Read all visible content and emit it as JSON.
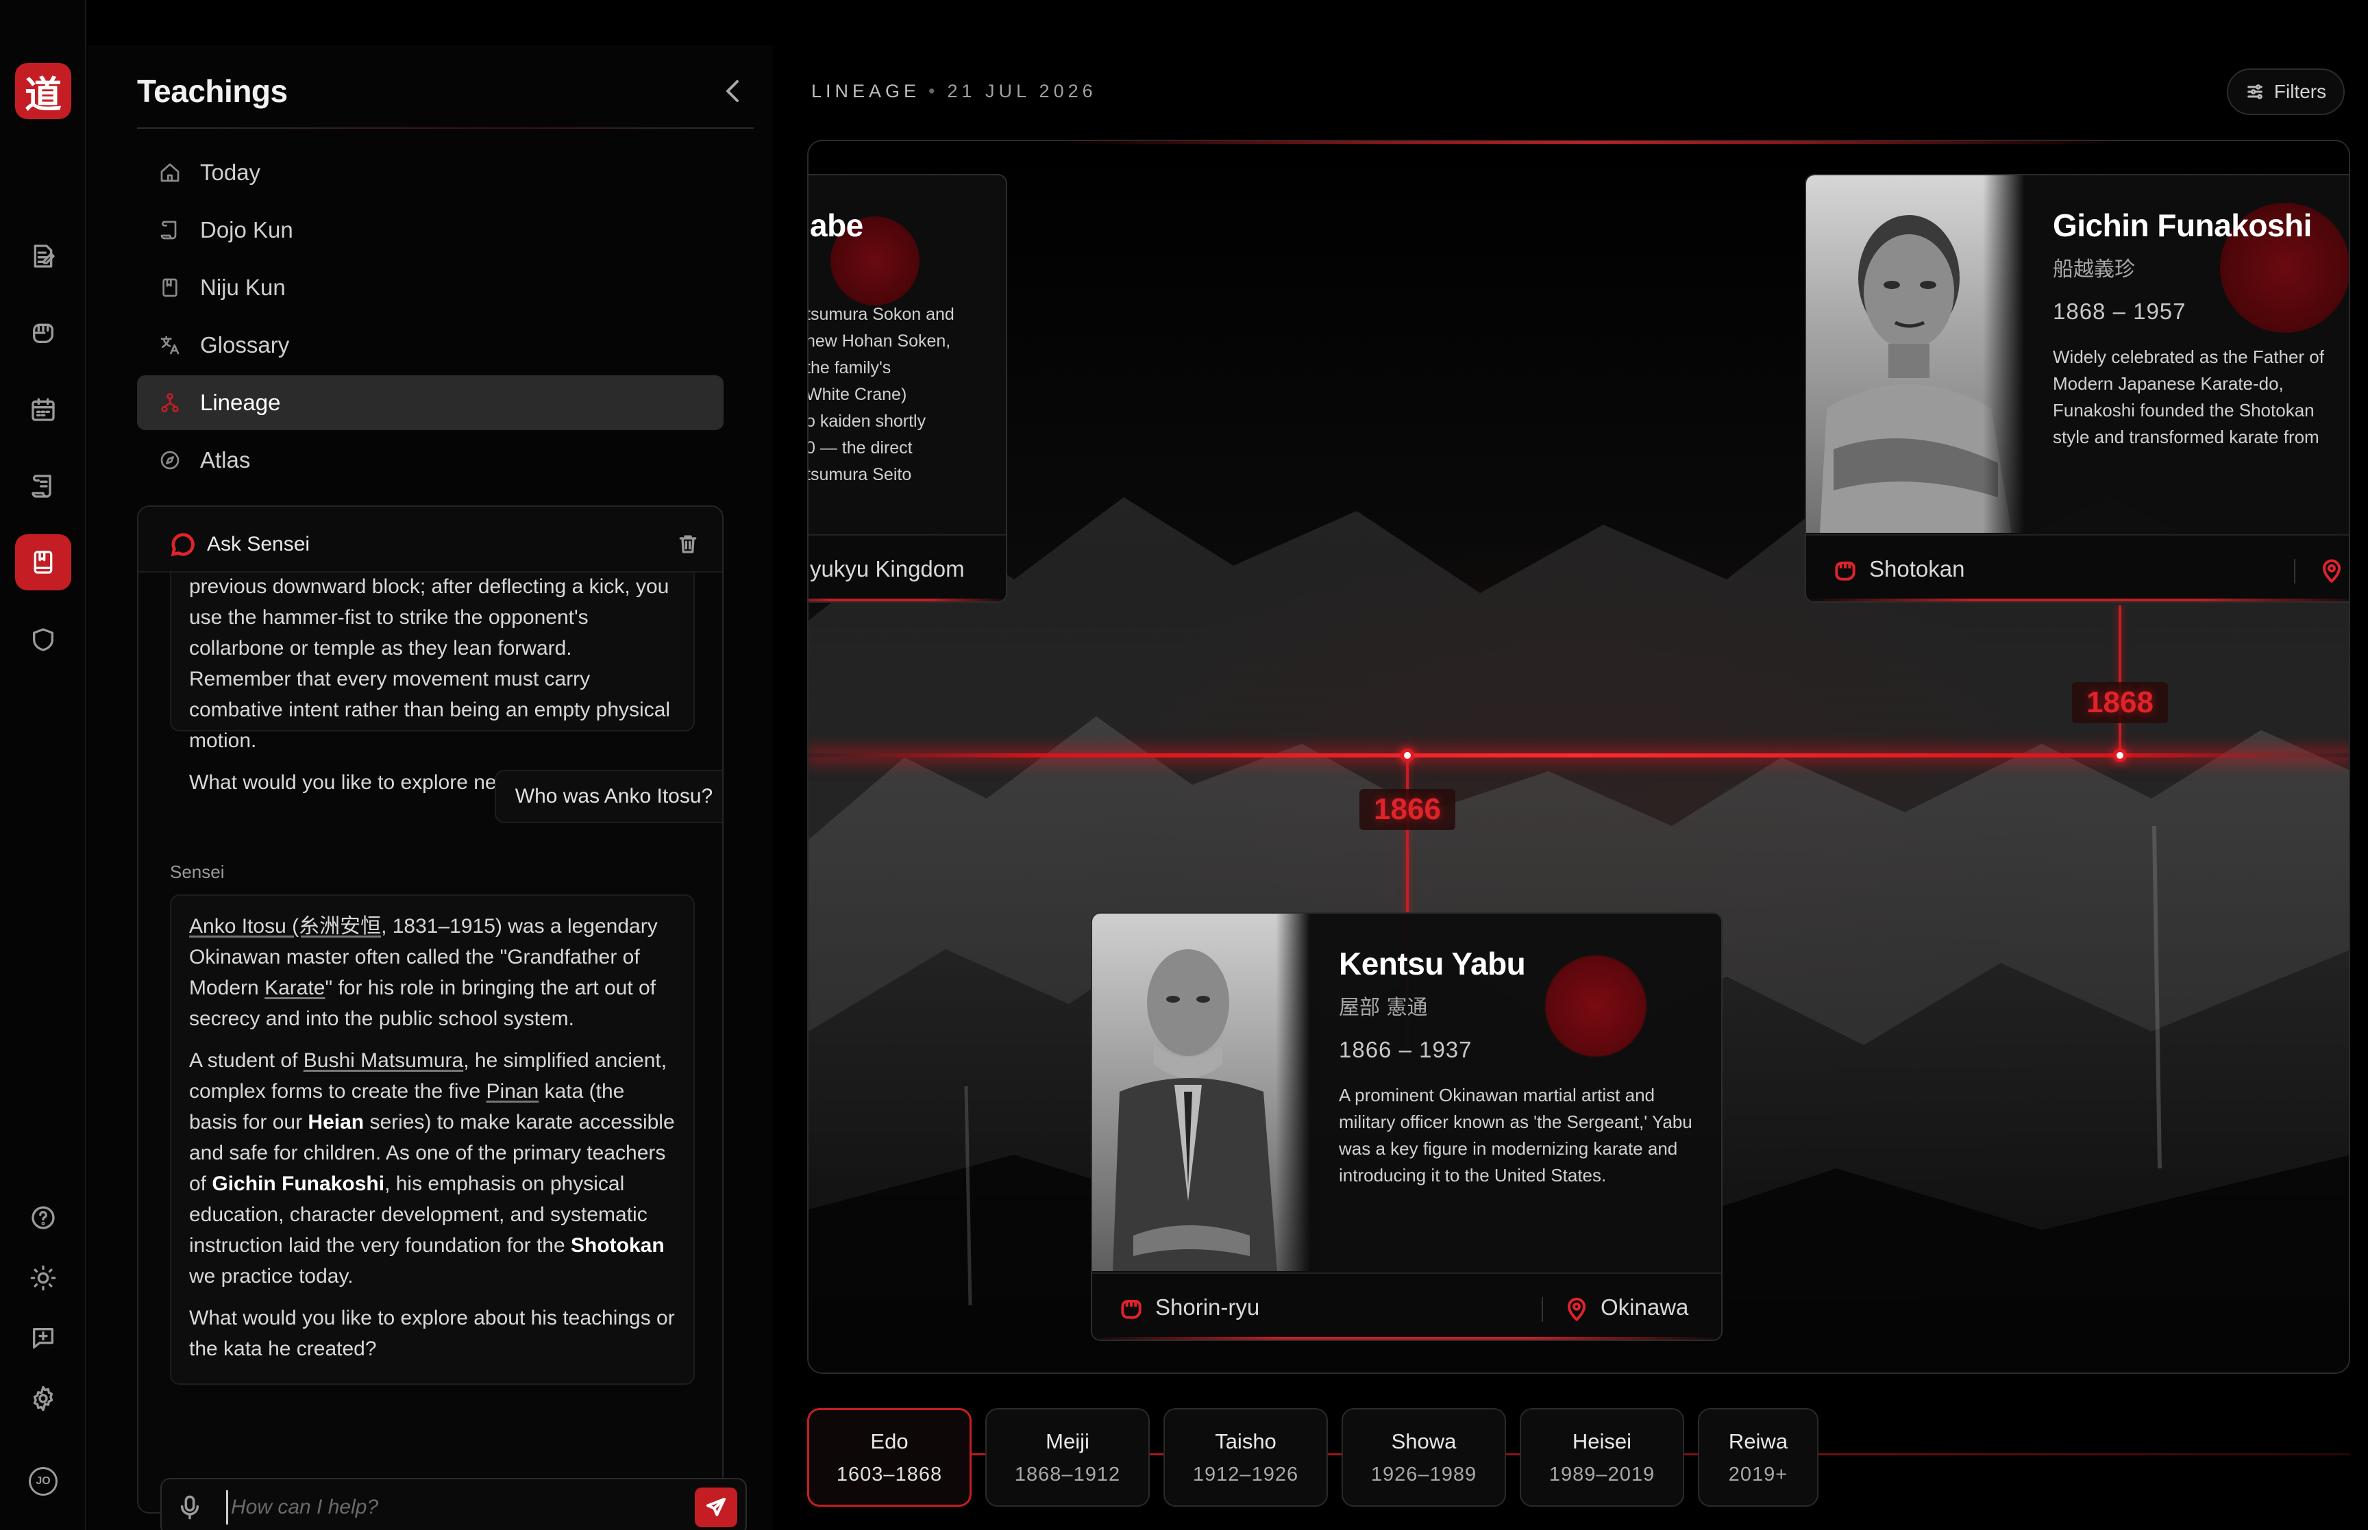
{
  "app": {
    "logo_glyph": "道",
    "brand_color": "#c41e24"
  },
  "rail": {
    "items": [
      {
        "name": "journal-icon"
      },
      {
        "name": "fist-icon"
      },
      {
        "name": "calendar-icon"
      },
      {
        "name": "scroll-icon"
      },
      {
        "name": "book-icon",
        "active": true
      },
      {
        "name": "shield-icon"
      }
    ],
    "bottom": [
      {
        "name": "help-icon"
      },
      {
        "name": "sun-icon"
      },
      {
        "name": "feedback-icon"
      },
      {
        "name": "gear-icon"
      }
    ],
    "avatar_initials": "JO"
  },
  "sidebar": {
    "title": "Teachings",
    "nav": [
      {
        "label": "Today",
        "icon": "home-icon"
      },
      {
        "label": "Dojo Kun",
        "icon": "scroll-icon"
      },
      {
        "label": "Niju Kun",
        "icon": "book-icon"
      },
      {
        "label": "Glossary",
        "icon": "translate-icon"
      },
      {
        "label": "Lineage",
        "icon": "lineage-icon",
        "active": true
      },
      {
        "label": "Atlas",
        "icon": "compass-icon"
      }
    ]
  },
  "ask": {
    "title": "Ask Sensei",
    "messages": {
      "prev_1": "previous downward block; after deflecting a kick, you use the hammer-fist to strike the opponent's collarbone or temple as they lean forward. Remember that every movement must carry combative intent rather than being an empty physical motion.",
      "prev_2": "What would you like to explore next?",
      "user": "Who was Anko Itosu?",
      "sensei_label": "Sensei",
      "reply": {
        "p1_a": "Anko Itosu (糸洲安恒",
        "p1_b": ", 1831–1915) was a legendary Okinawan master often called the \"Grandfather of Modern ",
        "p1_c": "Karate",
        "p1_d": "\" for his role in bringing the art out of secrecy and into the public school system.",
        "p2_a": "A student of ",
        "p2_b": "Bushi Matsumura",
        "p2_c": ", he simplified ancient, complex forms to create the five ",
        "p2_d": "Pinan",
        "p2_e": " kata (the basis for our ",
        "p2_f": "Heian",
        "p2_g": " series) to make karate accessible and safe for children. As one of the primary teachers of ",
        "p2_h": "Gichin Funakoshi",
        "p2_i": ", his emphasis on physical education, character development, and systematic instruction laid the very foundation for the ",
        "p2_j": "Shotokan",
        "p2_k": " we practice today.",
        "p3": "What would you like to explore about his teachings or the kata he created?"
      }
    },
    "input_placeholder": "How can I help?"
  },
  "main": {
    "section": "LINEAGE",
    "date": "21 JUL 2026",
    "filters_label": "Filters"
  },
  "timeline": {
    "markers": [
      "1866",
      "1868"
    ],
    "cards": {
      "left_partial": {
        "name_fragment": "abe",
        "desc_lines": [
          "tsumura Sokon and",
          "new Hohan Soken,",
          "the family's",
          "White Crane)",
          "o kaiden shortly",
          "0 — the direct",
          "tsumura Seito"
        ],
        "location": "yukyu Kingdom"
      },
      "funakoshi": {
        "name": "Gichin Funakoshi",
        "kanji": "船越義珍",
        "years": "1868 – 1957",
        "desc": "Widely celebrated as the Father of Modern Japanese Karate-do, Funakoshi founded the Shotokan style and transformed karate from an Okinawan self-defense method into a global philosophical art.",
        "style": "Shotokan"
      },
      "yabu": {
        "name": "Kentsu Yabu",
        "kanji": "屋部 憲通",
        "years": "1866 – 1937",
        "desc": "A prominent Okinawan martial artist and military officer known as 'the Sergeant,' Yabu was a key figure in modernizing karate and introducing it to the United States.",
        "style": "Shorin-ryu",
        "location": "Okinawa"
      }
    }
  },
  "eras": [
    {
      "name": "Edo",
      "years": "1603–1868",
      "active": true
    },
    {
      "name": "Meiji",
      "years": "1868–1912"
    },
    {
      "name": "Taisho",
      "years": "1912–1926"
    },
    {
      "name": "Showa",
      "years": "1926–1989"
    },
    {
      "name": "Heisei",
      "years": "1989–2019"
    },
    {
      "name": "Reiwa",
      "years": "2019+"
    }
  ]
}
